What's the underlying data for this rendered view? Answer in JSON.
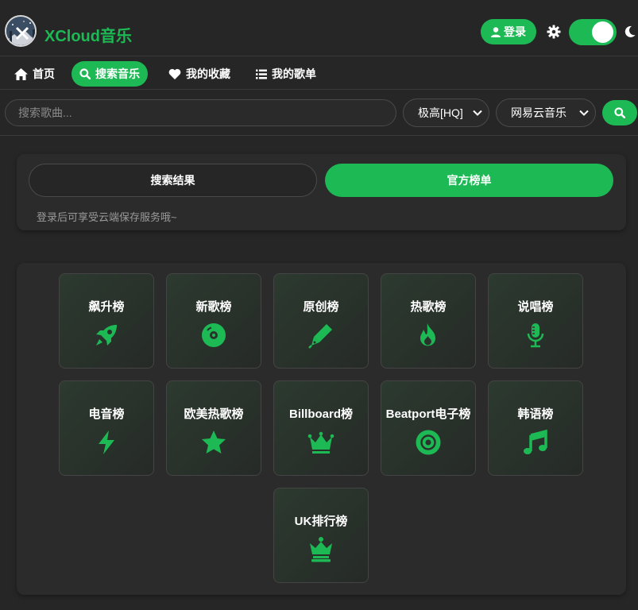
{
  "app": {
    "brand": "XCloud音乐",
    "accent": "#1db954"
  },
  "header": {
    "login_label": "登录"
  },
  "nav": {
    "items": [
      {
        "label": "首页",
        "icon": "home-icon"
      },
      {
        "label": "搜索音乐",
        "icon": "search-icon",
        "active": true
      },
      {
        "label": "我的收藏",
        "icon": "heart-icon"
      },
      {
        "label": "我的歌单",
        "icon": "list-icon"
      }
    ]
  },
  "search": {
    "placeholder": "搜索歌曲...",
    "quality": "极高[HQ]",
    "source": "网易云音乐"
  },
  "tabs": {
    "results": "搜索结果",
    "charts": "官方榜单"
  },
  "hint": "登录后可享受云端保存服务哦~",
  "charts": [
    {
      "label": "飙升榜",
      "icon": "rocket-icon"
    },
    {
      "label": "新歌榜",
      "icon": "record-icon"
    },
    {
      "label": "原创榜",
      "icon": "pen-icon"
    },
    {
      "label": "热歌榜",
      "icon": "fire-icon"
    },
    {
      "label": "说唱榜",
      "icon": "microphone-icon"
    },
    {
      "label": "电音榜",
      "icon": "bolt-icon"
    },
    {
      "label": "欧美热歌榜",
      "icon": "star-icon"
    },
    {
      "label": "Billboard榜",
      "icon": "crown-icon"
    },
    {
      "label": "Beatport电子榜",
      "icon": "disc-icon"
    },
    {
      "label": "韩语榜",
      "icon": "music-note-icon"
    },
    {
      "label": "UK排行榜",
      "icon": "chess-queen-icon"
    }
  ]
}
